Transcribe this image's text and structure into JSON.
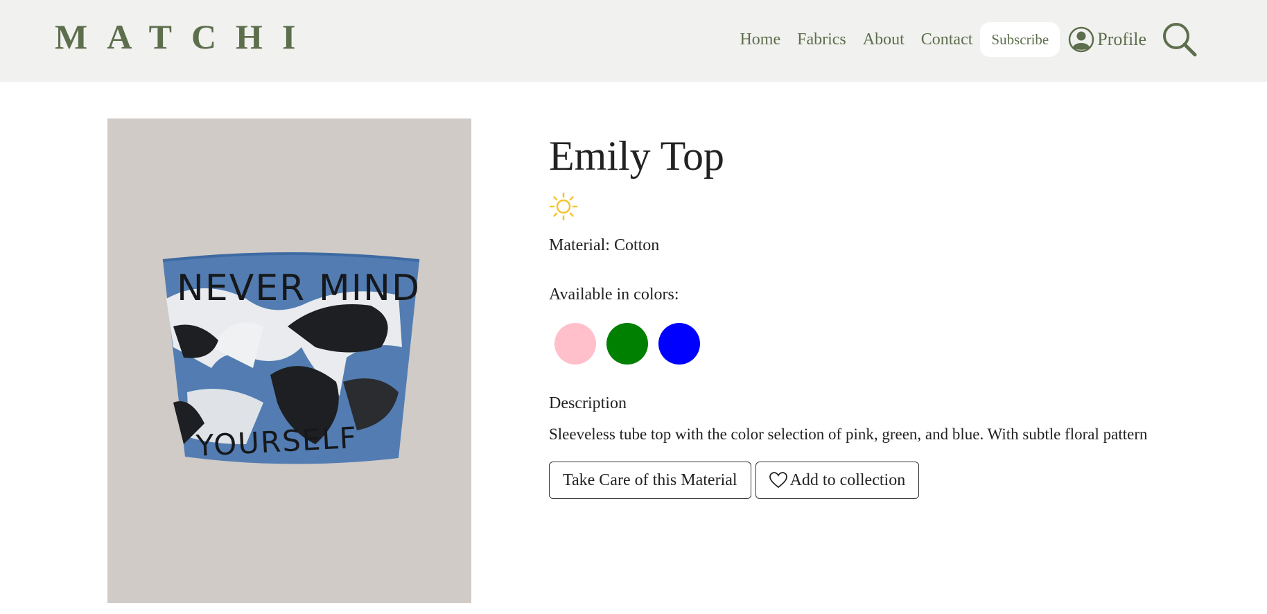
{
  "header": {
    "logo": "MATCHI",
    "nav": [
      "Home",
      "Fabrics",
      "About",
      "Contact"
    ],
    "subscribe_label": "Subscribe",
    "profile_label": "Profile",
    "brand_color": "#5d6e4c"
  },
  "product": {
    "image_text": [
      "NEVER MIND",
      "YOURSELF"
    ],
    "title": "Emily Top",
    "season_icon": "sun-icon",
    "material": "Material: Cotton",
    "colors_label": "Available in colors:",
    "colors": [
      "#ffc0cb",
      "#008000",
      "#0000ff"
    ],
    "description_heading": "Description",
    "description": "Sleeveless tube top with the color selection of pink, green, and blue. With subtle floral pattern",
    "care_button": "Take Care of this Material",
    "add_button": "Add to collection"
  }
}
